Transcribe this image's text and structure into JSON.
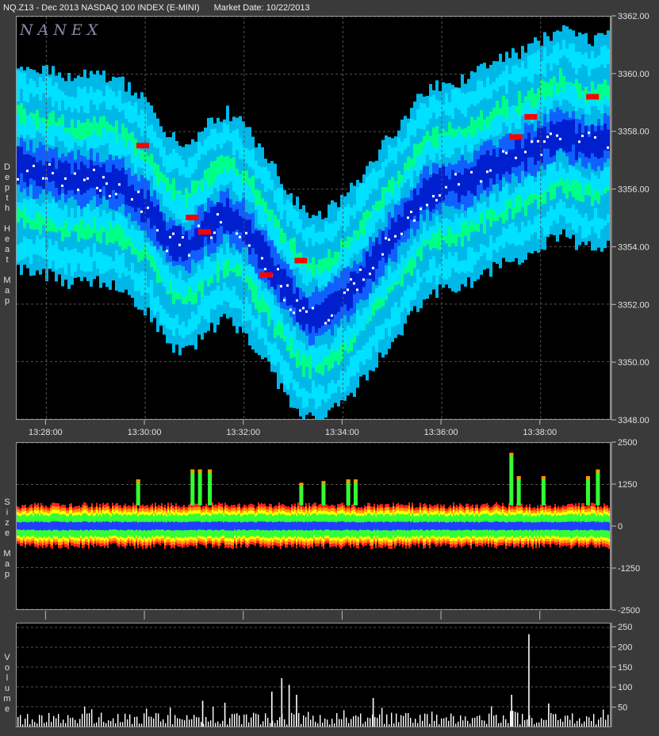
{
  "header": {
    "symbol": "NQ.Z13 - Dec 2013 NASDAQ 100 INDEX (E-MINI)",
    "market_date": "Market Date: 10/22/2013"
  },
  "logo": "NANEX",
  "panels": {
    "depth": {
      "label": "Depth Heat Map"
    },
    "size": {
      "label": "Size Map"
    },
    "volume": {
      "label": "Volume"
    }
  },
  "colors": {
    "heat_outer": "#00b8e8",
    "heat_cyan": "#00e0ff",
    "heat_green": "#00ff88",
    "heat_lime": "#00ee33",
    "heat_blue": "#1060ff",
    "heat_darkblue": "#0020d0",
    "heat_red": "#ff0000",
    "trade_white": "#ffffff",
    "size_red": "#ff2020",
    "size_orange": "#ff9900",
    "size_yellow": "#ffff00",
    "size_green": "#33ff33",
    "size_blue": "#2040ff"
  },
  "chart_data": [
    {
      "type": "heatmap",
      "name": "depth-heat-map",
      "xticks": [
        "13:28:00",
        "13:30:00",
        "13:32:00",
        "13:34:00",
        "13:36:00",
        "13:38:00"
      ],
      "yticks": [
        "3362.00",
        "3360.00",
        "3358.00",
        "3356.00",
        "3354.00",
        "3352.00",
        "3350.00",
        "3348.00"
      ],
      "ylim": [
        3348,
        3362
      ],
      "xlim_minutes": [
        13.4,
        25.4
      ],
      "grid": true,
      "center_price": [
        [
          13.4,
          3356.8
        ],
        [
          14.0,
          3356.6
        ],
        [
          14.5,
          3356.3
        ],
        [
          15.0,
          3356.4
        ],
        [
          15.5,
          3356.1
        ],
        [
          16.0,
          3355.4
        ],
        [
          16.4,
          3354.3
        ],
        [
          16.8,
          3353.9
        ],
        [
          17.2,
          3354.6
        ],
        [
          17.6,
          3355.1
        ],
        [
          18.0,
          3354.6
        ],
        [
          18.4,
          3353.6
        ],
        [
          18.8,
          3352.5
        ],
        [
          19.2,
          3351.6
        ],
        [
          19.6,
          3351.6
        ],
        [
          20.0,
          3352.2
        ],
        [
          20.4,
          3353.0
        ],
        [
          20.8,
          3354.0
        ],
        [
          21.2,
          3354.8
        ],
        [
          21.6,
          3355.8
        ],
        [
          22.0,
          3356.1
        ],
        [
          22.4,
          3356.2
        ],
        [
          22.8,
          3356.6
        ],
        [
          23.2,
          3357.0
        ],
        [
          23.6,
          3357.2
        ],
        [
          24.0,
          3357.6
        ],
        [
          24.4,
          3358.0
        ],
        [
          24.8,
          3357.6
        ],
        [
          25.2,
          3357.6
        ],
        [
          25.4,
          3357.8
        ]
      ],
      "red_orders": [
        {
          "t": 15.95,
          "price": 3357.5
        },
        {
          "t": 16.95,
          "price": 3355.0
        },
        {
          "t": 17.2,
          "price": 3354.5
        },
        {
          "t": 18.45,
          "price": 3353.0
        },
        {
          "t": 19.15,
          "price": 3353.5
        },
        {
          "t": 23.5,
          "price": 3357.8
        },
        {
          "t": 23.8,
          "price": 3358.5
        },
        {
          "t": 25.05,
          "price": 3359.2
        }
      ]
    },
    {
      "type": "area",
      "name": "size-map",
      "yticks": [
        "2500",
        "1250",
        "0",
        "-1250",
        "-2500"
      ],
      "ylim": [
        -2500,
        2500
      ],
      "baseline_upper": 620,
      "baseline_lower": -600,
      "spikes": [
        {
          "t": 15.85,
          "value": 1400
        },
        {
          "t": 16.95,
          "value": 1700
        },
        {
          "t": 17.1,
          "value": 1700
        },
        {
          "t": 17.3,
          "value": 1700
        },
        {
          "t": 19.15,
          "value": 1300
        },
        {
          "t": 19.6,
          "value": 1350
        },
        {
          "t": 20.1,
          "value": 1400
        },
        {
          "t": 20.25,
          "value": 1400
        },
        {
          "t": 23.4,
          "value": 2200
        },
        {
          "t": 23.55,
          "value": 1500
        },
        {
          "t": 24.05,
          "value": 1500
        },
        {
          "t": 24.95,
          "value": 1500
        },
        {
          "t": 25.15,
          "value": 1700
        }
      ]
    },
    {
      "type": "bar",
      "name": "volume",
      "yticks": [
        "250",
        "200",
        "150",
        "100",
        "50"
      ],
      "ylim": [
        0,
        260
      ],
      "typical_range": [
        5,
        35
      ],
      "spikes": [
        {
          "t": 17.15,
          "value": 65
        },
        {
          "t": 17.6,
          "value": 60
        },
        {
          "t": 18.55,
          "value": 88
        },
        {
          "t": 18.75,
          "value": 122
        },
        {
          "t": 18.9,
          "value": 105
        },
        {
          "t": 19.05,
          "value": 80
        },
        {
          "t": 20.6,
          "value": 72
        },
        {
          "t": 23.4,
          "value": 80
        },
        {
          "t": 23.75,
          "value": 233
        },
        {
          "t": 24.15,
          "value": 58
        }
      ]
    }
  ]
}
